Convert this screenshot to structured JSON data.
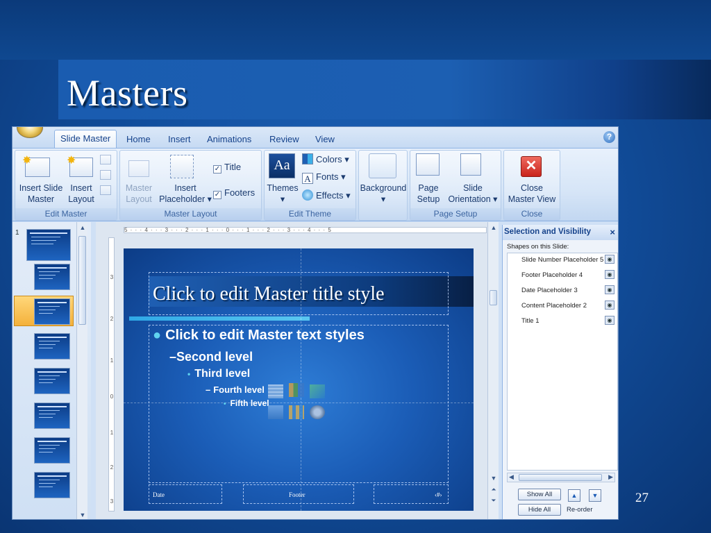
{
  "slide": {
    "title": "Masters",
    "page_number": "27"
  },
  "app": {
    "tabs": [
      "Slide Master",
      "Home",
      "Insert",
      "Animations",
      "Review",
      "View"
    ],
    "active_tab": "Slide Master",
    "help_label": "?"
  },
  "ribbon": {
    "edit_master": {
      "label": "Edit Master",
      "insert_slide_master": [
        "Insert Slide",
        "Master"
      ],
      "insert_layout": [
        "Insert",
        "Layout"
      ]
    },
    "master_layout": {
      "label": "Master Layout",
      "master_layout": [
        "Master",
        "Layout"
      ],
      "insert_placeholder": [
        "Insert",
        "Placeholder"
      ],
      "title_check": "Title",
      "footers_check": "Footers"
    },
    "edit_theme": {
      "label": "Edit Theme",
      "themes": "Themes",
      "themes_icon_text": "Aa",
      "colors": "Colors",
      "fonts": "Fonts",
      "fonts_icon_text": "A",
      "effects": "Effects"
    },
    "background": {
      "label": "Background"
    },
    "page_setup": {
      "label": "Page Setup",
      "page_setup": [
        "Page",
        "Setup"
      ],
      "slide_orientation": [
        "Slide",
        "Orientation"
      ]
    },
    "close": {
      "label": "Close",
      "close_master_view": [
        "Close",
        "Master View"
      ]
    }
  },
  "thumbnails": {
    "first_index": "1",
    "count": 8,
    "selected_index": 2
  },
  "master_slide": {
    "title_placeholder": "Click to edit Master title style",
    "levels": [
      "Click to edit Master text styles",
      "Second level",
      "Third level",
      "Fourth level",
      "Fifth level"
    ],
    "bullets": [
      "●",
      "–",
      "•",
      "–",
      "•"
    ],
    "date": "Date",
    "footer": "Footer",
    "slide_number": "‹#›"
  },
  "selection_pane": {
    "title": "Selection and Visibility",
    "close": "×",
    "subheading": "Shapes on this Slide:",
    "items": [
      "Slide Number Placeholder 5",
      "Footer Placeholder 4",
      "Date Placeholder 3",
      "Content Placeholder 2",
      "Title 1"
    ],
    "show_all": "Show All",
    "hide_all": "Hide All",
    "reorder": "Re-order"
  },
  "colors": {
    "accent": "#1b5db7",
    "ribbon_text": "#15428b",
    "close_red": "#d9302a"
  }
}
